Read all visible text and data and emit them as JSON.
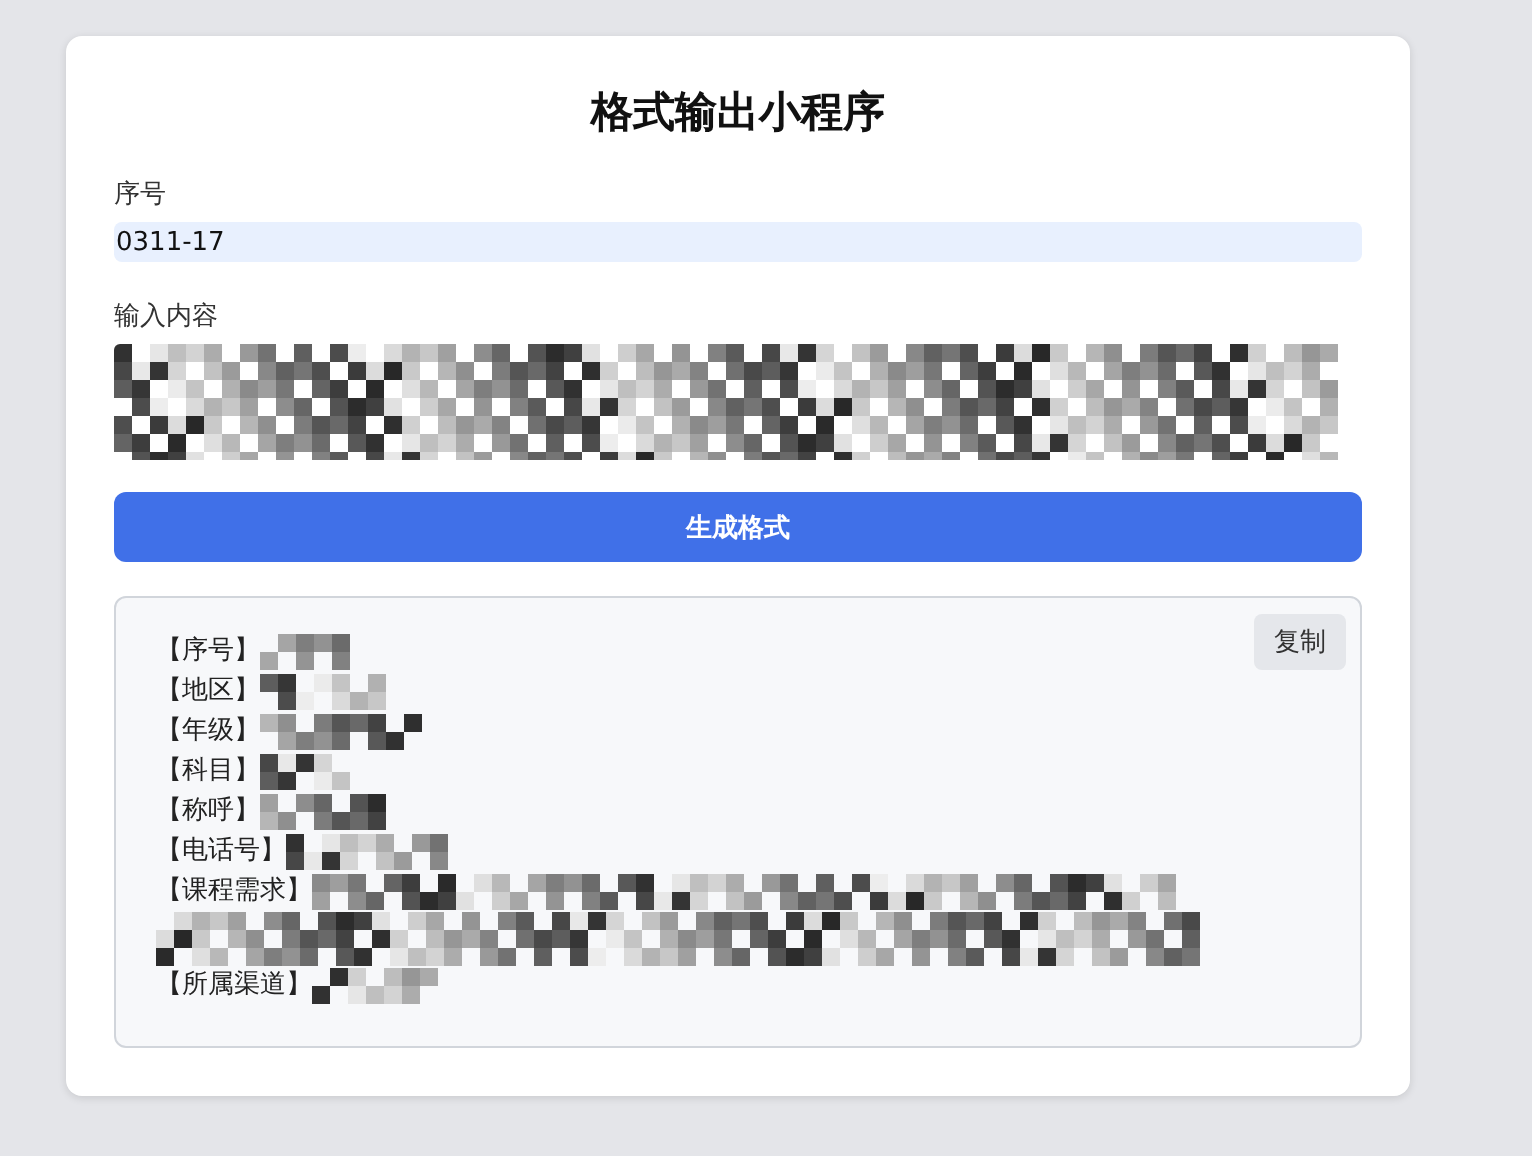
{
  "title": "格式输出小程序",
  "serial": {
    "label": "序号",
    "value": "0311-17"
  },
  "content": {
    "label": "输入内容"
  },
  "generate_button": "生成格式",
  "output": {
    "copy_button": "复制",
    "lines": [
      {
        "label": "【序号】",
        "kind": "short"
      },
      {
        "label": "【地区】",
        "kind": "short"
      },
      {
        "label": "【年级】",
        "kind": "short"
      },
      {
        "label": "【科目】",
        "kind": "short"
      },
      {
        "label": "【称呼】",
        "kind": "short"
      },
      {
        "label": "【电话号】",
        "kind": "short"
      },
      {
        "label": "【课程需求】",
        "kind": "long"
      },
      {
        "label": "【所属渠道】",
        "kind": "short"
      }
    ]
  }
}
